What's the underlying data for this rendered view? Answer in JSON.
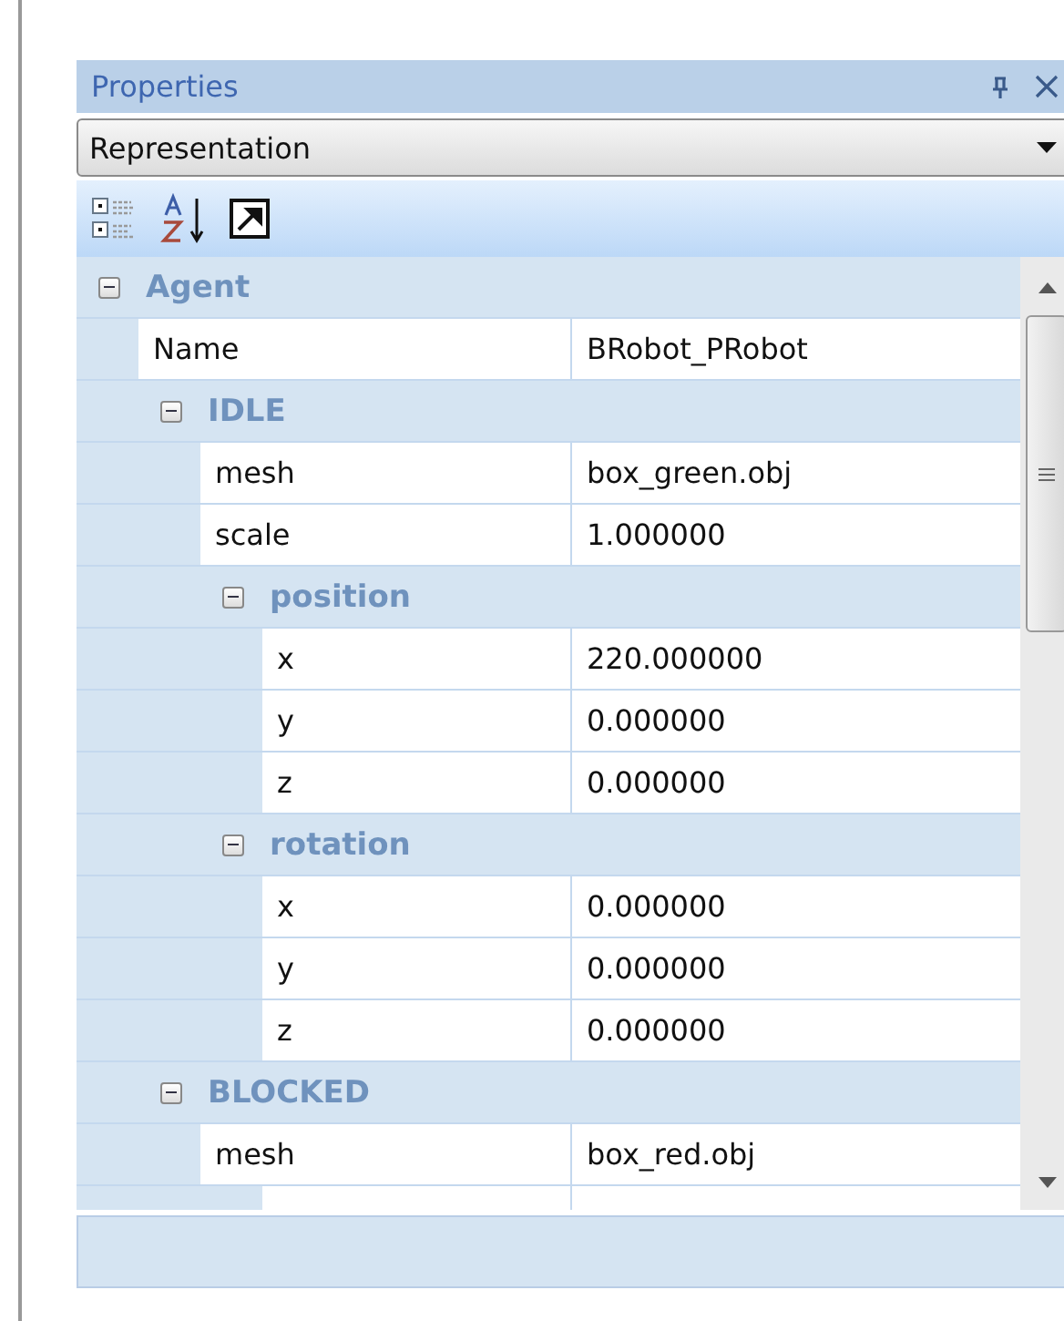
{
  "panel": {
    "title": "Properties"
  },
  "object_selector": {
    "value": "Representation"
  },
  "toolbar": [
    {
      "kind": "categorized",
      "selected": false
    },
    {
      "kind": "alphabetical",
      "selected": false
    },
    {
      "kind": "pages",
      "selected": false
    }
  ],
  "grid": {
    "items": [
      {
        "kind": "category",
        "label": "Agent",
        "expanded": true,
        "children": [
          {
            "kind": "property",
            "name": "Name",
            "value": "BRobot_PRobot"
          },
          {
            "kind": "category",
            "label": "IDLE",
            "expanded": true,
            "children": [
              {
                "kind": "property",
                "name": "mesh",
                "value": "box_green.obj"
              },
              {
                "kind": "property",
                "name": "scale",
                "value": "1.000000"
              },
              {
                "kind": "category",
                "label": "position",
                "expanded": true,
                "children": [
                  {
                    "kind": "property",
                    "name": "x",
                    "value": "220.000000"
                  },
                  {
                    "kind": "property",
                    "name": "y",
                    "value": "0.000000"
                  },
                  {
                    "kind": "property",
                    "name": "z",
                    "value": "0.000000"
                  }
                ]
              },
              {
                "kind": "category",
                "label": "rotation",
                "expanded": true,
                "children": [
                  {
                    "kind": "property",
                    "name": "x",
                    "value": "0.000000"
                  },
                  {
                    "kind": "property",
                    "name": "y",
                    "value": "0.000000"
                  },
                  {
                    "kind": "property",
                    "name": "z",
                    "value": "0.000000"
                  }
                ]
              }
            ]
          },
          {
            "kind": "category",
            "label": "BLOCKED",
            "expanded": true,
            "children": [
              {
                "kind": "property",
                "name": "mesh",
                "value": "box_red.obj"
              }
            ]
          }
        ]
      }
    ]
  }
}
